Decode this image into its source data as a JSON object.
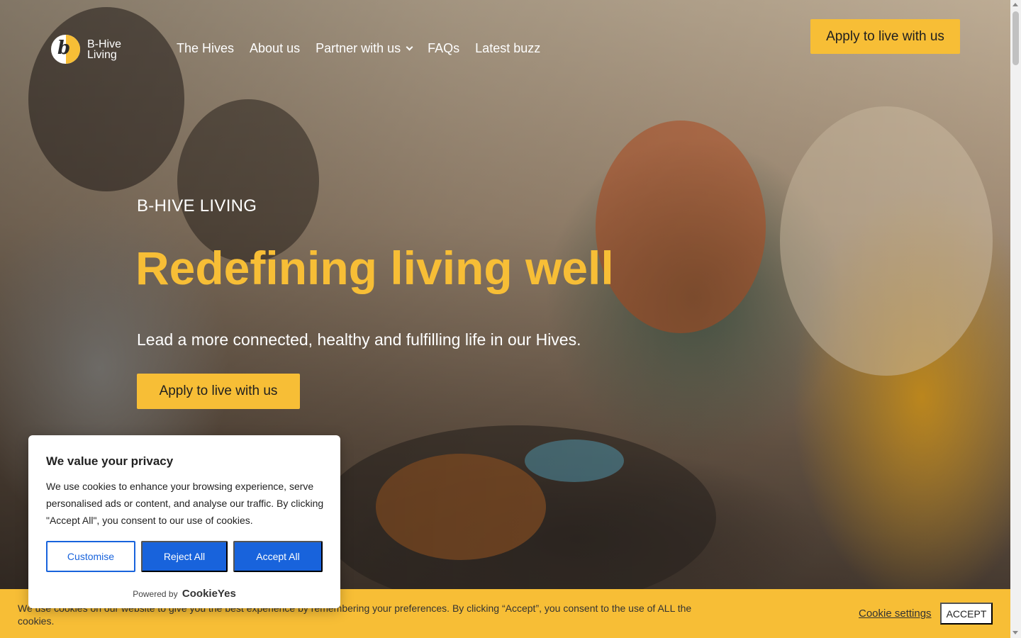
{
  "header": {
    "logo_text": "B-Hive Living",
    "logo_glyph": "b",
    "nav": [
      {
        "label": "The Hives"
      },
      {
        "label": "About us"
      },
      {
        "label": "Partner with us",
        "has_dropdown": true
      },
      {
        "label": "FAQs"
      },
      {
        "label": "Latest buzz"
      }
    ],
    "cta_label": "Apply to live with us"
  },
  "hero": {
    "eyebrow": "B-HIVE LIVING",
    "headline": "Redefining living well",
    "subline": "Lead a more connected, healthy and fulfilling life in our Hives.",
    "cta_label": "Apply to live with us"
  },
  "privacy_modal": {
    "title": "We value your privacy",
    "body": "We use cookies to enhance your browsing experience, serve personalised ads or content, and analyse our traffic. By clicking \"Accept All\", you consent to our use of cookies.",
    "customise_label": "Customise",
    "reject_label": "Reject All",
    "accept_label": "Accept All",
    "powered_by": "Powered by",
    "powered_brand": "CookieYes"
  },
  "cookie_bar": {
    "text": "We use cookies on our website to give you the best experience by remembering your preferences. By clicking “Accept”, you consent to the use of ALL the cookies.",
    "settings_label": "Cookie settings",
    "accept_label": "ACCEPT"
  },
  "colors": {
    "brand_yellow": "#f7be36",
    "consent_blue": "#1863dc"
  },
  "icons": [
    "logo-icon",
    "chevron-down-icon",
    "scroll-up-icon",
    "scroll-down-icon"
  ]
}
